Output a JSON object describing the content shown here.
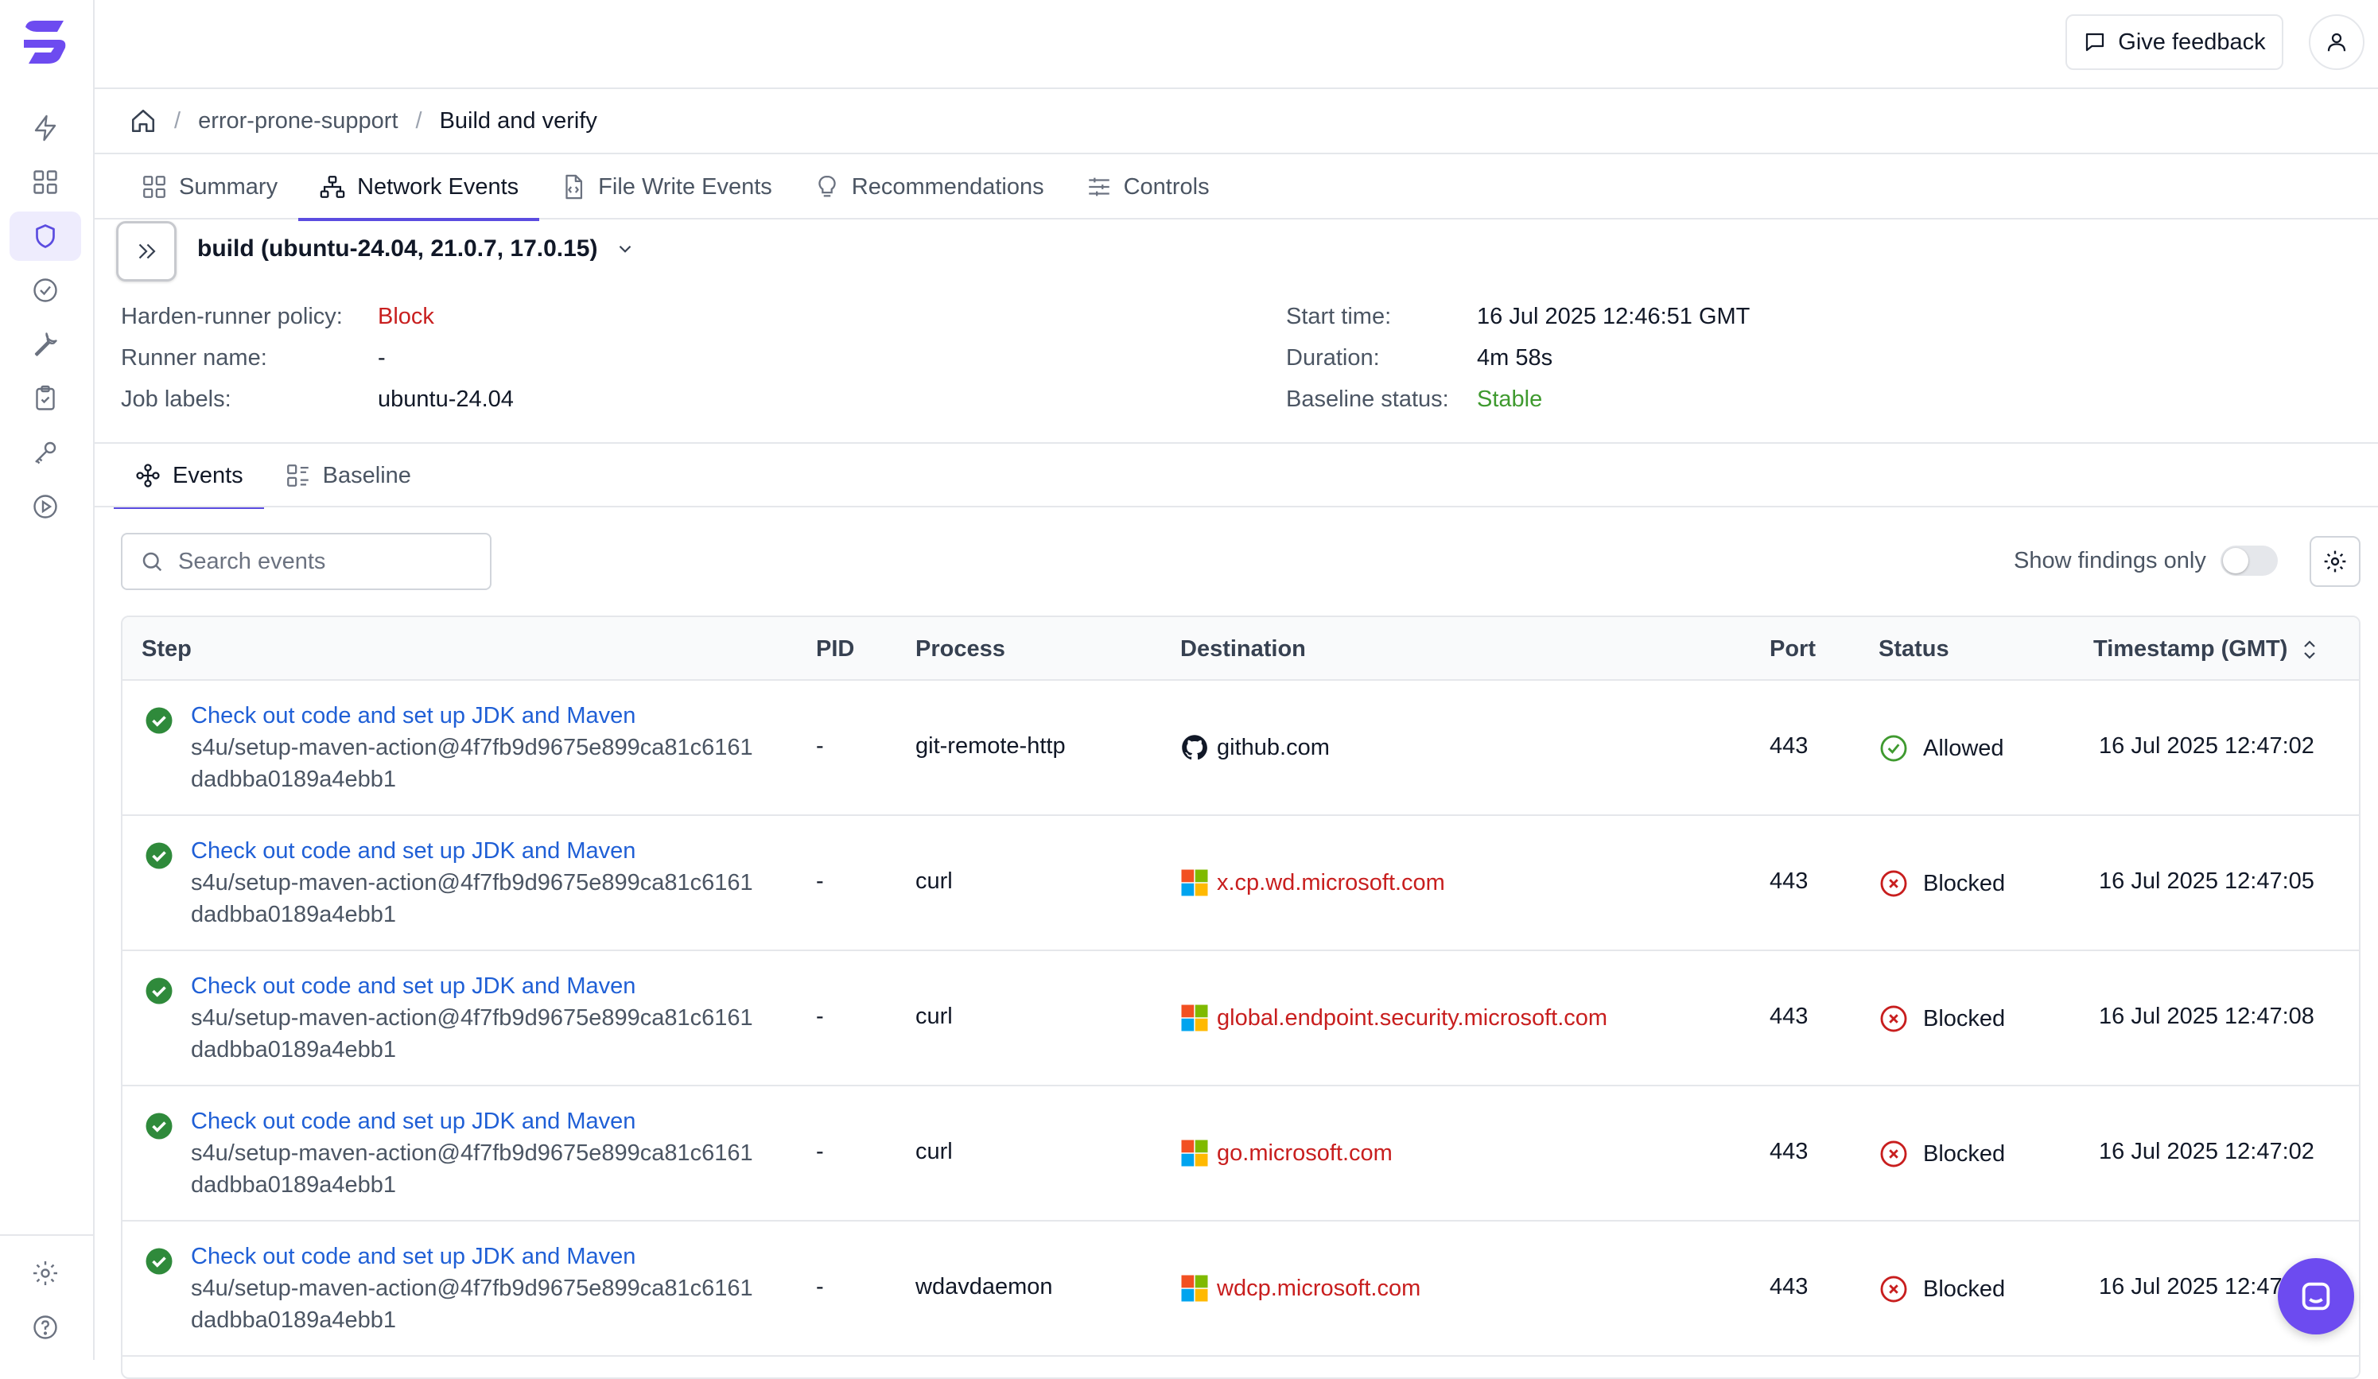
{
  "colors": {
    "accent": "#5b4ce0",
    "link": "#1f5fd6",
    "danger": "#c81e1e",
    "success": "#3f9a2f",
    "chat": "#6d4bf0"
  },
  "sidebar": {
    "items": [
      {
        "icon": "bolt-icon"
      },
      {
        "icon": "grid-icon"
      },
      {
        "icon": "shield-icon",
        "active": true
      },
      {
        "icon": "check-circle-icon"
      },
      {
        "icon": "wrench-icon"
      },
      {
        "icon": "clipboard-check-icon"
      },
      {
        "icon": "key-icon"
      },
      {
        "icon": "play-circle-icon"
      }
    ],
    "bottom": [
      {
        "icon": "gear-icon"
      },
      {
        "icon": "help-icon"
      }
    ]
  },
  "topbar": {
    "feedback_label": "Give feedback"
  },
  "breadcrumb": {
    "repo": "error-prone-support",
    "current": "Build and verify"
  },
  "tabs": [
    {
      "label": "Summary"
    },
    {
      "label": "Network Events",
      "active": true
    },
    {
      "label": "File Write Events"
    },
    {
      "label": "Recommendations"
    },
    {
      "label": "Controls"
    }
  ],
  "job": {
    "title": "build (ubuntu-24.04, 21.0.7, 17.0.15)",
    "policy_label": "Harden-runner policy:",
    "policy_value": "Block",
    "runner_label": "Runner name:",
    "runner_value": "-",
    "labels_label": "Job labels:",
    "labels_value": "ubuntu-24.04",
    "start_label": "Start time:",
    "start_value": "16 Jul 2025 12:46:51 GMT",
    "duration_label": "Duration:",
    "duration_value": "4m 58s",
    "baseline_label": "Baseline status:",
    "baseline_value": "Stable"
  },
  "subtabs": [
    {
      "label": "Events",
      "active": true
    },
    {
      "label": "Baseline"
    }
  ],
  "toolbar": {
    "search_placeholder": "Search events",
    "findings_label": "Show findings only",
    "findings_on": false
  },
  "table": {
    "headers": {
      "step": "Step",
      "pid": "PID",
      "process": "Process",
      "destination": "Destination",
      "port": "Port",
      "status": "Status",
      "timestamp": "Timestamp (GMT)"
    },
    "rows": [
      {
        "step": "Check out code and set up JDK and Maven",
        "action": "s4u/setup-maven-action@4f7fb9d9675e899ca81c6161",
        "action2": "dadbba0189a4ebb1",
        "pid": "-",
        "process": "git-remote-http",
        "destination": "github.com",
        "dest_icon": "github-icon",
        "port": "443",
        "status": "Allowed",
        "timestamp": "16 Jul 2025 12:47:02"
      },
      {
        "step": "Check out code and set up JDK and Maven",
        "action": "s4u/setup-maven-action@4f7fb9d9675e899ca81c6161",
        "action2": "dadbba0189a4ebb1",
        "pid": "-",
        "process": "curl",
        "destination": "x.cp.wd.microsoft.com",
        "dest_icon": "microsoft-icon",
        "port": "443",
        "status": "Blocked",
        "timestamp": "16 Jul 2025 12:47:05"
      },
      {
        "step": "Check out code and set up JDK and Maven",
        "action": "s4u/setup-maven-action@4f7fb9d9675e899ca81c6161",
        "action2": "dadbba0189a4ebb1",
        "pid": "-",
        "process": "curl",
        "destination": "global.endpoint.security.microsoft.com",
        "dest_icon": "microsoft-icon",
        "port": "443",
        "status": "Blocked",
        "timestamp": "16 Jul 2025 12:47:08"
      },
      {
        "step": "Check out code and set up JDK and Maven",
        "action": "s4u/setup-maven-action@4f7fb9d9675e899ca81c6161",
        "action2": "dadbba0189a4ebb1",
        "pid": "-",
        "process": "curl",
        "destination": "go.microsoft.com",
        "dest_icon": "microsoft-icon",
        "port": "443",
        "status": "Blocked",
        "timestamp": "16 Jul 2025 12:47:02"
      },
      {
        "step": "Check out code and set up JDK and Maven",
        "action": "s4u/setup-maven-action@4f7fb9d9675e899ca81c6161",
        "action2": "dadbba0189a4ebb1",
        "pid": "-",
        "process": "wdavdaemon",
        "destination": "wdcp.microsoft.com",
        "dest_icon": "microsoft-icon",
        "port": "443",
        "status": "Blocked",
        "timestamp": "16 Jul 2025 12:47:0"
      }
    ]
  }
}
